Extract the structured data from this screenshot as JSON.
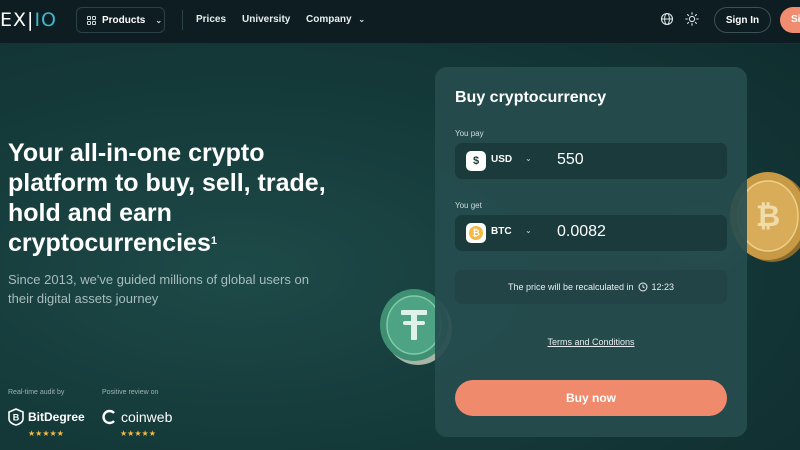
{
  "header": {
    "logo_part1": "EX",
    "logo_part2": "IO",
    "products_label": "Products",
    "nav": [
      "Prices",
      "University",
      "Company"
    ],
    "signin_label": "Sign In",
    "signup_label": "Sign Up"
  },
  "hero": {
    "title": "Your all-in-one crypto platform to buy, sell, trade, hold and earn cryptocurrencies",
    "title_footnote": "1",
    "subtitle": "Since 2013, we've guided millions of global users on their digital assets journey",
    "audit_label": "Real-time audit by",
    "review_label": "Positive review on",
    "brand1": "BitDegree",
    "brand2": "coinweb",
    "stars1": "★★★★★",
    "stars2": "★★★★★"
  },
  "card": {
    "title": "Buy cryptocurrency",
    "pay_label": "You pay",
    "pay_currency": "USD",
    "pay_symbol": "$",
    "pay_amount": "550",
    "get_label": "You get",
    "get_currency": "BTC",
    "get_symbol": "₿",
    "get_amount": "0.0082",
    "notice_text": "The price will be recalculated in",
    "notice_time": "12:23",
    "terms_label": "Terms and Conditions",
    "buy_label": "Buy now"
  },
  "colors": {
    "accent": "#f08a6c",
    "logo_accent": "#3fb8c8",
    "card_bg": "#264c4e",
    "header_bg": "#0e1d22",
    "star": "#f4b942"
  },
  "icons": {
    "products": "grid-icon",
    "language": "globe-icon",
    "theme": "sun-icon",
    "timer": "clock-icon"
  }
}
